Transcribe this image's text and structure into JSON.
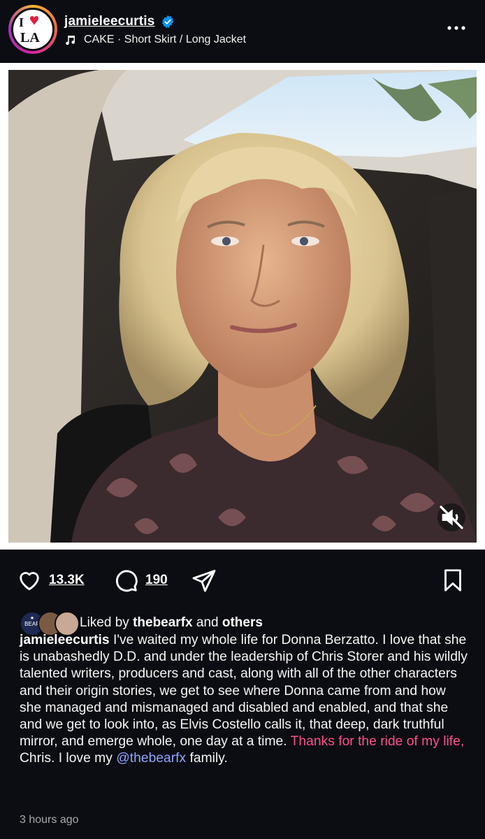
{
  "header": {
    "username": "jamieleecurtis",
    "audio_label": "CAKE · Short Skirt / Long Jacket",
    "avatar_icon": "i-love-la-logo",
    "verified_icon": "verified-badge-icon",
    "more_icon": "more-options-icon"
  },
  "post": {
    "photo_description_icon": "photo",
    "mute_icon": "muted-speaker-icon"
  },
  "actions": {
    "likes": "13.3K",
    "comments": "190",
    "like_icon": "heart-icon",
    "comment_icon": "comment-bubble-icon",
    "share_icon": "paper-plane-icon",
    "save_icon": "bookmark-icon"
  },
  "liked_by": {
    "prefix": "Liked by",
    "user": "thebearfx",
    "connector": "and",
    "others": "others",
    "avatar_badge": "BEAR"
  },
  "caption": {
    "username": "jamieleecurtis",
    "text_part1": " I've waited my whole life for Donna Berzatto. I love that she is unabashedly D.D. and under the leadership of Chris Storer and his wildly talented writers, producers and cast, along with all of the other characters and their origin stories, we get to see where Donna came from and how she managed and mismanaged and disabled and enabled, and that she and we get to look into, as Elvis Costello calls it, that deep, dark truthful mirror, and emerge whole, one day at a time. ",
    "highlight": "Thanks for the ride of my life,",
    "text_part2": " Chris. I love my ",
    "mention": "@thebearfx",
    "text_part3": " family."
  },
  "timestamp": "3 hours ago",
  "colors": {
    "background": "#0c0d12",
    "highlight": "#ff4f8b",
    "mention": "#8fa4ff",
    "verified": "#0095f6"
  }
}
